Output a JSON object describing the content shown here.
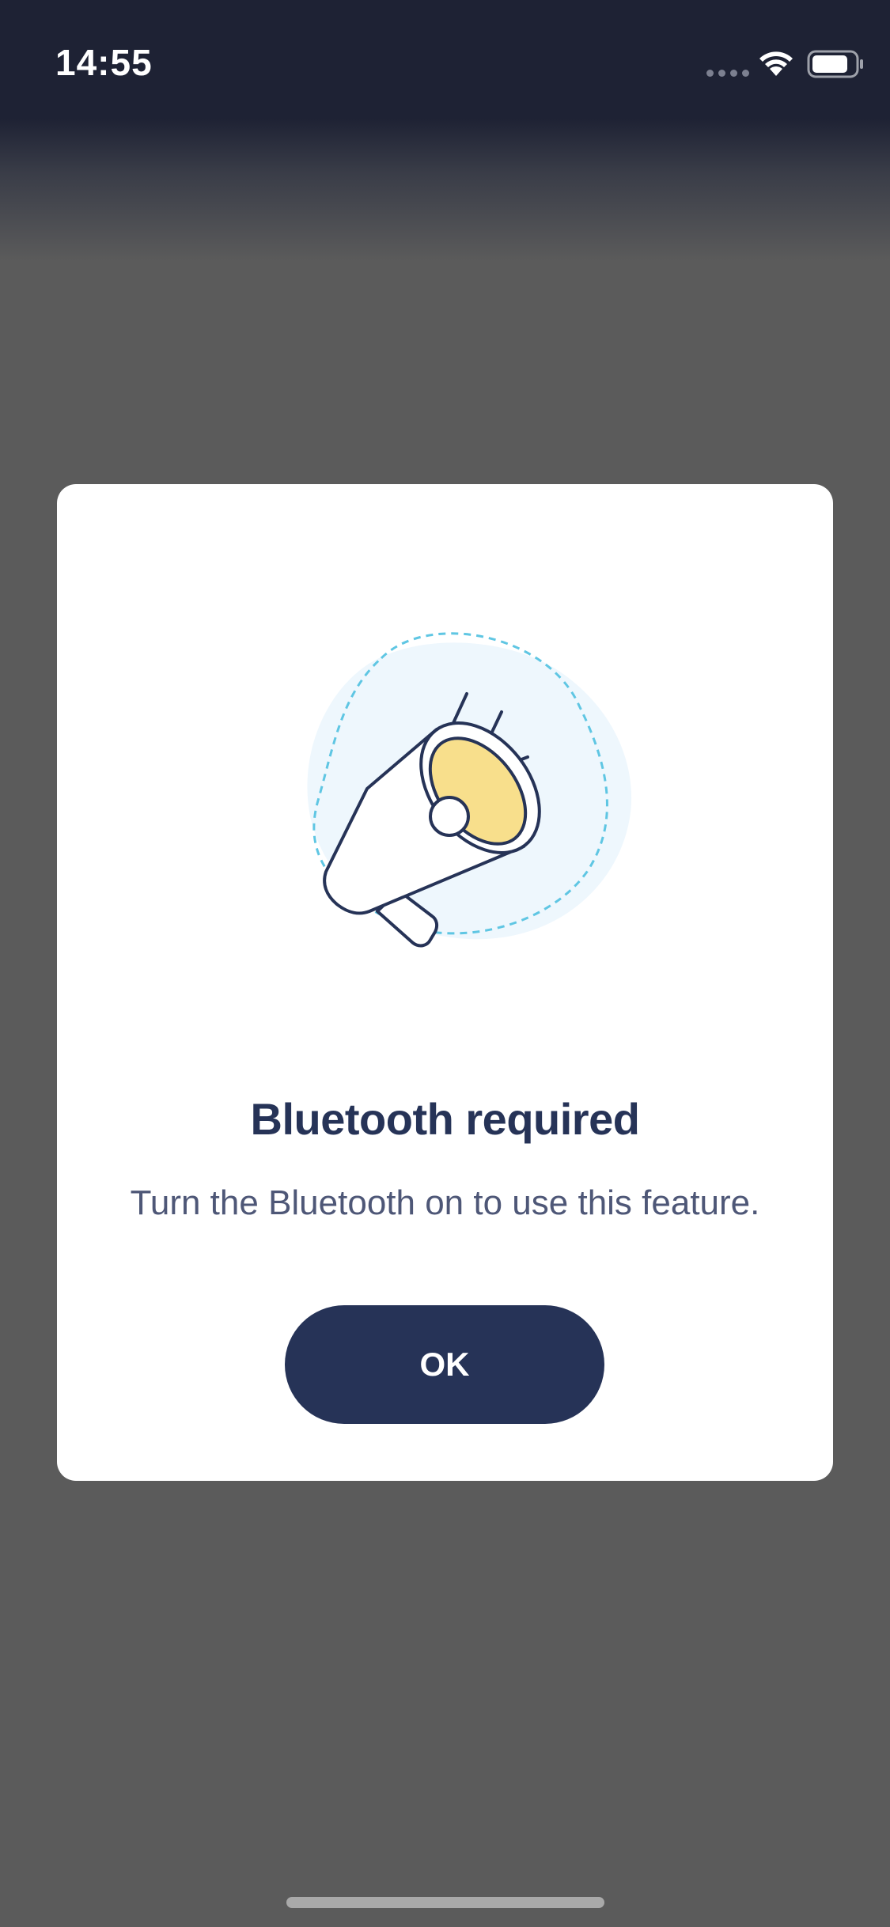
{
  "status_bar": {
    "time": "14:55"
  },
  "dialog": {
    "illustration": "megaphone-icon",
    "title": "Bluetooth required",
    "message": "Turn the Bluetooth on to use this feature.",
    "ok_label": "OK"
  },
  "colors": {
    "primary": "#263357",
    "message_text": "#4e5777",
    "overlay": "#5b5b5b",
    "status_bar_bg": "#1e2234",
    "megaphone_accent": "#f8df8c",
    "blob": "#eef7fd",
    "dashed_outline": "#5fc6e3"
  }
}
